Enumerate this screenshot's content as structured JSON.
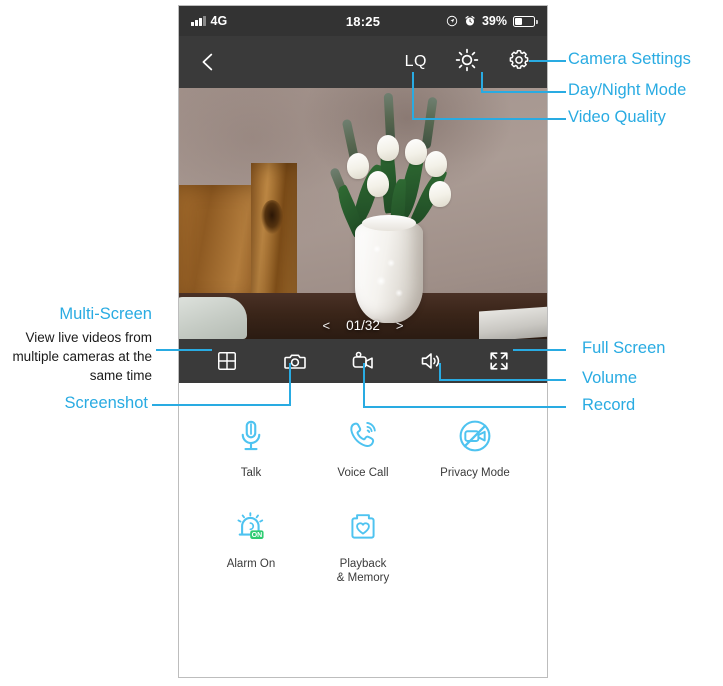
{
  "phone": {
    "status_bar": {
      "carrier": "4G",
      "time": "18:25",
      "battery_percent": "39%",
      "icons": [
        "signal-bars-icon",
        "location-icon",
        "alarm-clock-icon",
        "battery-icon"
      ]
    },
    "nav_bar": {
      "back_icon": "chevron-left-icon",
      "quality_label": "LQ",
      "daynight_icon": "sun-icon",
      "settings_icon": "gear-icon"
    },
    "video": {
      "pager_prev": "<",
      "pager_text": "01/32",
      "pager_next": ">",
      "scene": "bedroom with white tulips in a white vase on a dark wooden nightstand"
    },
    "toolbar": [
      {
        "name": "multi-screen",
        "icon": "grid-icon"
      },
      {
        "name": "screenshot",
        "icon": "camera-icon"
      },
      {
        "name": "record",
        "icon": "video-camera-icon"
      },
      {
        "name": "volume",
        "icon": "speaker-icon"
      },
      {
        "name": "full-screen",
        "icon": "expand-arrows-icon"
      }
    ],
    "functions": [
      {
        "label": "Talk",
        "icon": "microphone-icon"
      },
      {
        "label": "Voice Call",
        "icon": "phone-waves-icon"
      },
      {
        "label": "Privacy Mode",
        "icon": "camera-off-icon"
      },
      {
        "label": "Alarm On",
        "icon": "alarm-bell-icon",
        "badge": "ON"
      },
      {
        "label": "Playback\n& Memory",
        "icon": "sd-card-heart-icon",
        "line1": "Playback",
        "line2": "& Memory"
      }
    ]
  },
  "annotations": {
    "camera_settings": "Camera Settings",
    "day_night_mode": "Day/Night Mode",
    "video_quality": "Video Quality",
    "full_screen": "Full Screen",
    "volume": "Volume",
    "record": "Record",
    "multi_screen_title": "Multi-Screen",
    "multi_screen_desc": "View live videos from multiple cameras at the same time",
    "screenshot": "Screenshot"
  },
  "colors": {
    "accent_blue": "#29abe2",
    "icon_blue": "#4ec3f0",
    "badge_green": "#2ecc71",
    "bar_dark": "#3a3a3a",
    "status_dark": "#333333"
  }
}
